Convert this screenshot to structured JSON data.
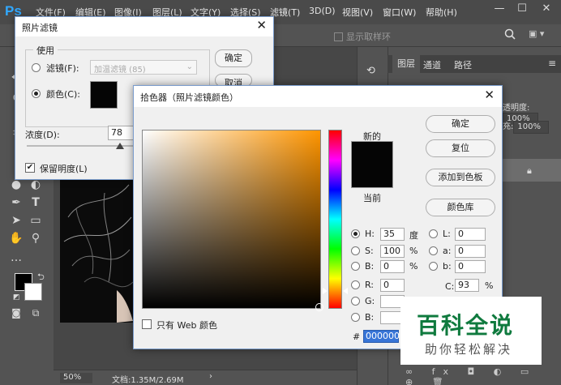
{
  "app": {
    "logo": "Ps",
    "menus": [
      "文件(F)",
      "编辑(E)",
      "图像(I)",
      "图层(L)",
      "文字(Y)",
      "选择(S)",
      "滤镜(T)",
      "3D(D)",
      "视图(V)",
      "窗口(W)",
      "帮助(H)"
    ],
    "window_controls": [
      "—",
      "☐",
      "✕"
    ]
  },
  "options_bar": {
    "sample_ring_label": "显示取样环"
  },
  "status_bar": {
    "zoom": "50%",
    "doc_size": "文档:1.35M/2.69M",
    "arrow": "›"
  },
  "layers_panel": {
    "tabs": [
      "图层",
      "通道",
      "路径"
    ],
    "opacity_label": "透明度:",
    "opacity_value": "100%",
    "fill_label": "充:",
    "fill_value": "100%",
    "menu_glyph": "≡"
  },
  "photo_filter_dialog": {
    "title": "照片滤镜",
    "group_label": "使用",
    "filter_label": "滤镜(F):",
    "filter_value": "加温滤镜 (85)",
    "color_label": "颜色(C):",
    "ok_label": "确定",
    "cancel_label": "取消",
    "density_label": "浓度(D):",
    "density_value": "78",
    "preserve_label": "保留明度(L)",
    "swatch_color": "#050505"
  },
  "color_picker_dialog": {
    "title": "拾色器（照片滤镜颜色）",
    "new_label": "新的",
    "current_label": "当前",
    "buttons": {
      "ok": "确定",
      "reset": "复位",
      "add_swatch": "添加到色板",
      "color_libraries": "颜色库"
    },
    "web_only_label": "只有 Web 颜色",
    "hsb": {
      "h_label": "H:",
      "h_value": "35",
      "h_unit": "度",
      "s_label": "S:",
      "s_value": "100",
      "s_unit": "%",
      "b_label": "B:",
      "b_value": "0",
      "b_unit": "%"
    },
    "lab": {
      "l_label": "L:",
      "l_value": "0",
      "a_label": "a:",
      "a_value": "0",
      "b_label": "b:",
      "b_value": "0"
    },
    "rgb": {
      "r_label": "R:",
      "r_value": "0",
      "g_label": "G:",
      "b_label": "B:"
    },
    "cmyk": {
      "c_label": "C:",
      "c_value": "93",
      "c_unit": "%"
    },
    "hex_label": "#",
    "hex_value": "000000",
    "hue_color": "#ff9500"
  },
  "watermark": {
    "title": "百科全说",
    "subtitle": "助你轻松解决"
  }
}
